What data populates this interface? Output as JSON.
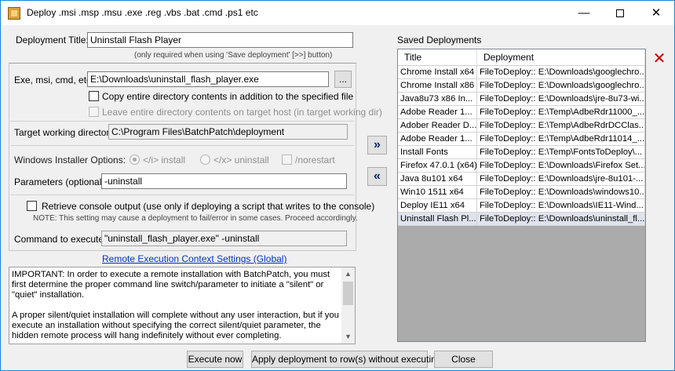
{
  "window": {
    "title": "Deploy .msi .msp .msu .exe .reg .vbs .bat .cmd .ps1 etc",
    "minimize_glyph": "—",
    "close_glyph": "✕"
  },
  "deployment_title": {
    "label": "Deployment Title:",
    "value": "Uninstall Flash Player",
    "note": "(only required when using 'Save deployment' [>>] button)"
  },
  "exe": {
    "label": "Exe, msi, cmd, etc:",
    "value": "E:\\Downloads\\uninstall_flash_player.exe",
    "browse_label": "...",
    "copy_dir_label": "Copy entire directory contents in addition to the specified file",
    "leave_dir_label": "Leave entire directory contents on target host (in target working dir)"
  },
  "target_dir": {
    "label": "Target working directory:",
    "value": "C:\\Program Files\\BatchPatch\\deployment"
  },
  "installer_options": {
    "label": "Windows Installer Options:",
    "install_label": "</i> install",
    "uninstall_label": "</x> uninstall",
    "norestart_label": "/norestart"
  },
  "parameters": {
    "label": "Parameters (optional):",
    "value": "-uninstall"
  },
  "console": {
    "label": "Retrieve console output (use only if deploying a script that writes to the console)",
    "note": "NOTE: This setting may cause a deployment to fail/error in some cases.  Proceed accordingly."
  },
  "command": {
    "label": "Command to execute:",
    "value": "\"uninstall_flash_player.exe\" -uninstall"
  },
  "remote_link": "Remote Execution Context Settings (Global)",
  "info": {
    "p1": "IMPORTANT: In order to execute a remote installation with BatchPatch, you must first determine the proper command line switch/parameter to initiate a \"silent\" or \"quiet\" installation.",
    "p2": "A proper silent/quiet installation will complete without any user interaction, but if you execute an installation without specifying the correct silent/quiet parameter, the hidden remote process will hang indefinitely without ever completing."
  },
  "buttons": {
    "execute": "Execute now",
    "apply": "Apply deployment to row(s) without executing",
    "close": "Close",
    "save_arrow": "»",
    "load_arrow": "«",
    "delete": "✕"
  },
  "saved": {
    "heading": "Saved Deployments",
    "col_title": "Title",
    "col_deployment": "Deployment",
    "rows": [
      {
        "title": "Chrome Install x64",
        "deployment": "FileToDeploy:: E:\\Downloads\\googlechro..."
      },
      {
        "title": "Chrome Install x86",
        "deployment": "FileToDeploy:: E:\\Downloads\\googlechro..."
      },
      {
        "title": "Java8u73 x86 In...",
        "deployment": "FileToDeploy:: E:\\Downloads\\jre-8u73-wi..."
      },
      {
        "title": "Adobe Reader 1...",
        "deployment": "FileToDeploy:: E:\\Temp\\AdbeRdr11000_..."
      },
      {
        "title": "Adober Reader D...",
        "deployment": "FileToDeploy:: E:\\Temp\\AdbeRdrDCClas..."
      },
      {
        "title": "Adobe Reader 1...",
        "deployment": "FileToDeploy:: E:\\Temp\\AdbeRdr11014_..."
      },
      {
        "title": "Install Fonts",
        "deployment": "FileToDeploy:: E:\\Temp\\FontsToDeploy\\..."
      },
      {
        "title": "Firefox 47.0.1 (x64)",
        "deployment": "FileToDeploy:: E:\\Downloads\\Firefox Set..."
      },
      {
        "title": "Java 8u101 x64",
        "deployment": "FileToDeploy:: E:\\Downloads\\jre-8u101-..."
      },
      {
        "title": "Win10 1511 x64",
        "deployment": "FileToDeploy:: E:\\Downloads\\windows10..."
      },
      {
        "title": "Deploy IE11 x64",
        "deployment": "FileToDeploy:: E:\\Downloads\\IE11-Wind..."
      },
      {
        "title": "Uninstall Flash Pl...",
        "deployment": "FileToDeploy:: E:\\Downloads\\uninstall_fl..."
      }
    ]
  }
}
